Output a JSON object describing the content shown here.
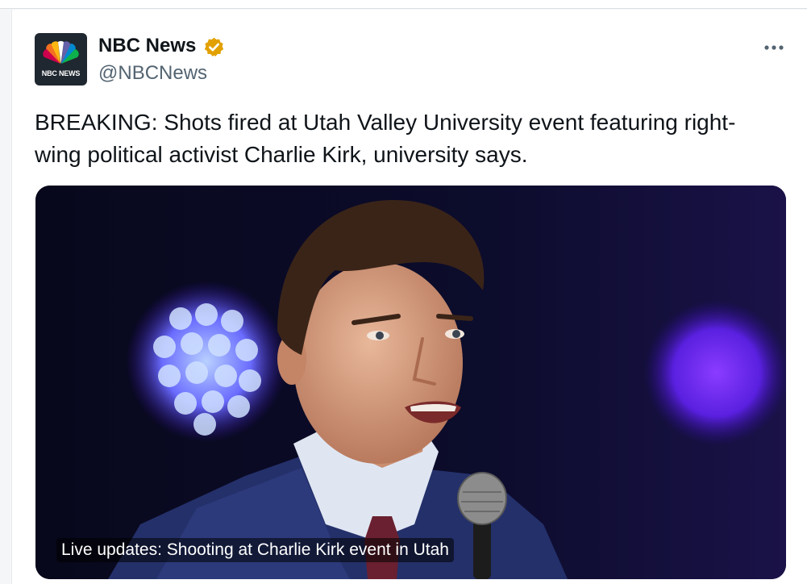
{
  "account": {
    "display_name": "NBC News",
    "handle": "@NBCNews",
    "avatar_text": "NBC NEWS",
    "verified_color": "#e2a100"
  },
  "tweet": {
    "text": "BREAKING: Shots fired at Utah Valley University event featuring right-wing political activist Charlie Kirk, university says."
  },
  "media": {
    "caption": "Live updates: Shooting at Charlie Kirk event in Utah"
  },
  "icons": {
    "avatar": "nbc-peacock-icon",
    "verified": "verified-badge-icon",
    "more": "more-horizontal-icon"
  },
  "colors": {
    "text": "#0f1419",
    "secondary": "#536471",
    "media_background": "#0b0c24"
  }
}
